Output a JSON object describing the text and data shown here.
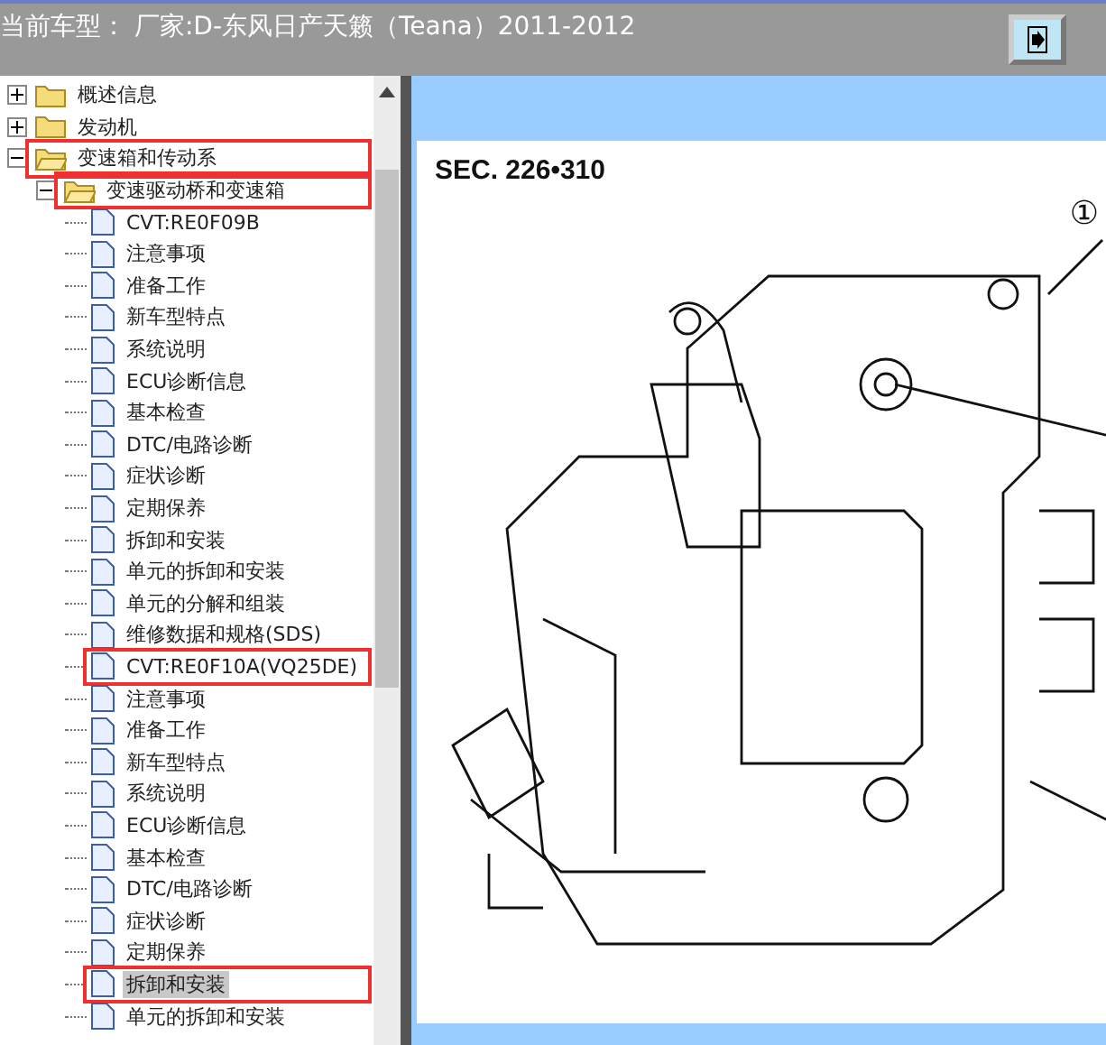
{
  "header": {
    "title": "当前车型： 厂家:D-东风日产天籁（Teana）2011-2012"
  },
  "tree": [
    {
      "label": "概述信息",
      "kind": "folder",
      "expanded": false,
      "selected": false,
      "boxed": false
    },
    {
      "label": "发动机",
      "kind": "folder",
      "expanded": false,
      "selected": false,
      "boxed": false
    },
    {
      "label": "变速箱和传动系",
      "kind": "folder",
      "expanded": true,
      "selected": false,
      "boxed": true,
      "children": [
        {
          "label": "变速驱动桥和变速箱",
          "kind": "folder",
          "expanded": true,
          "selected": false,
          "boxed": true,
          "children": [
            {
              "label": "CVT:RE0F09B",
              "kind": "page",
              "selected": false,
              "boxed": false
            },
            {
              "label": "注意事项",
              "kind": "page",
              "selected": false,
              "boxed": false
            },
            {
              "label": "准备工作",
              "kind": "page",
              "selected": false,
              "boxed": false
            },
            {
              "label": "新车型特点",
              "kind": "page",
              "selected": false,
              "boxed": false
            },
            {
              "label": "系统说明",
              "kind": "page",
              "selected": false,
              "boxed": false
            },
            {
              "label": "ECU诊断信息",
              "kind": "page",
              "selected": false,
              "boxed": false
            },
            {
              "label": "基本检查",
              "kind": "page",
              "selected": false,
              "boxed": false
            },
            {
              "label": "DTC/电路诊断",
              "kind": "page",
              "selected": false,
              "boxed": false
            },
            {
              "label": "症状诊断",
              "kind": "page",
              "selected": false,
              "boxed": false
            },
            {
              "label": "定期保养",
              "kind": "page",
              "selected": false,
              "boxed": false
            },
            {
              "label": "拆卸和安装",
              "kind": "page",
              "selected": false,
              "boxed": false
            },
            {
              "label": "单元的拆卸和安装",
              "kind": "page",
              "selected": false,
              "boxed": false
            },
            {
              "label": "单元的分解和组装",
              "kind": "page",
              "selected": false,
              "boxed": false
            },
            {
              "label": "维修数据和规格(SDS)",
              "kind": "page",
              "selected": false,
              "boxed": false
            },
            {
              "label": "CVT:RE0F10A(VQ25DE)",
              "kind": "page",
              "selected": false,
              "boxed": true
            },
            {
              "label": "注意事项",
              "kind": "page",
              "selected": false,
              "boxed": false
            },
            {
              "label": "准备工作",
              "kind": "page",
              "selected": false,
              "boxed": false
            },
            {
              "label": "新车型特点",
              "kind": "page",
              "selected": false,
              "boxed": false
            },
            {
              "label": "系统说明",
              "kind": "page",
              "selected": false,
              "boxed": false
            },
            {
              "label": "ECU诊断信息",
              "kind": "page",
              "selected": false,
              "boxed": false
            },
            {
              "label": "基本检查",
              "kind": "page",
              "selected": false,
              "boxed": false
            },
            {
              "label": "DTC/电路诊断",
              "kind": "page",
              "selected": false,
              "boxed": false
            },
            {
              "label": "症状诊断",
              "kind": "page",
              "selected": false,
              "boxed": false
            },
            {
              "label": "定期保养",
              "kind": "page",
              "selected": false,
              "boxed": false
            },
            {
              "label": "拆卸和安装",
              "kind": "page",
              "selected": true,
              "boxed": true
            },
            {
              "label": "单元的拆卸和安装",
              "kind": "page",
              "selected": false,
              "boxed": false
            }
          ]
        }
      ]
    }
  ],
  "document": {
    "section": "SEC. 226•310",
    "callout": "①"
  }
}
